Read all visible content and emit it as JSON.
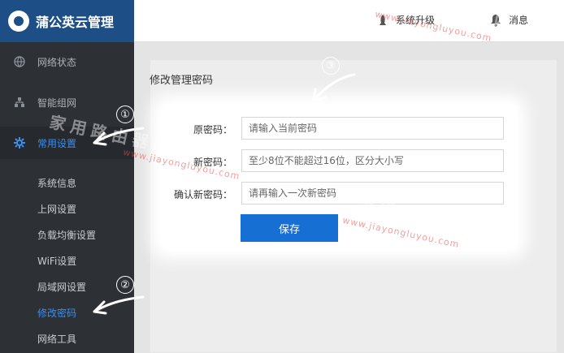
{
  "app": {
    "title": "蒲公英云管理"
  },
  "sidebar": {
    "items": [
      {
        "label": "网络状态",
        "icon": "globe-icon"
      },
      {
        "label": "智能组网",
        "icon": "network-icon"
      },
      {
        "label": "常用设置",
        "icon": "gear-icon"
      }
    ],
    "sub_items": [
      {
        "label": "系统信息"
      },
      {
        "label": "上网设置"
      },
      {
        "label": "负载均衡设置"
      },
      {
        "label": "WiFi设置"
      },
      {
        "label": "局域网设置"
      },
      {
        "label": "修改密码"
      },
      {
        "label": "网络工具"
      }
    ]
  },
  "topbar": {
    "upgrade_label": "系统升级",
    "messages_label": "消息"
  },
  "main": {
    "title": "修改管理密码",
    "form": {
      "old_label": "原密码：",
      "old_placeholder": "请输入当前密码",
      "new_label": "新密码：",
      "new_placeholder": "至少8位不能超过16位，区分大小写",
      "confirm_label": "确认新密码：",
      "confirm_placeholder": "请再输入一次新密码",
      "save_label": "保存"
    }
  },
  "annotations": {
    "n1": "①",
    "n2": "②",
    "n3": "③"
  },
  "watermark": {
    "cn": "家用路由器网",
    "url": "www.jiayongluyou.com"
  },
  "colors": {
    "accent": "#1670d4",
    "sidebar_bg": "#2d3035",
    "logo_bg": "#1d4f86",
    "active_text": "#3b8ff0"
  }
}
